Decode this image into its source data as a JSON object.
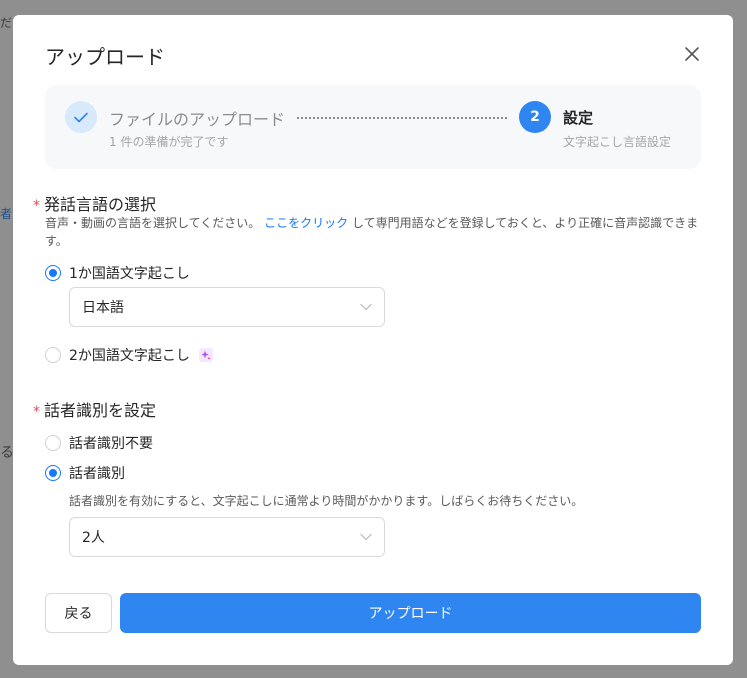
{
  "background": {
    "fragments": [
      "ださ",
      "者",
      "る"
    ]
  },
  "modal": {
    "title": "アップロード",
    "close_icon": "close-icon"
  },
  "stepper": {
    "step1": {
      "label": "ファイルのアップロード",
      "sub": "1 件の準備が完了です",
      "icon": "check-icon"
    },
    "step2": {
      "number": "2",
      "label": "設定",
      "sub": "文字起こし言語設定"
    }
  },
  "language": {
    "title": "発話言語の選択",
    "required_mark": "*",
    "desc_before": "音声・動画の言語を選択してください。",
    "desc_link": "ここをクリック",
    "desc_after": "して専門用語などを登録しておくと、より正確に音声認識できます。",
    "options": [
      {
        "label": "1か国語文字起こし",
        "checked": true
      },
      {
        "label": "2か国語文字起こし",
        "checked": false,
        "badge_icon": "sparkle-icon"
      }
    ],
    "selected_language": "日本語"
  },
  "speaker": {
    "title": "話者識別を設定",
    "required_mark": "*",
    "options": [
      {
        "label": "話者識別不要",
        "checked": false
      },
      {
        "label": "話者識別",
        "checked": true
      }
    ],
    "hint": "話者識別を有効にすると、文字起こしに通常より時間がかかります。しばらくお待ちください。",
    "selected_count": "2人"
  },
  "footer": {
    "back_label": "戻る",
    "upload_label": "アップロード"
  },
  "colors": {
    "primary": "#2f86f1",
    "link": "#1677ff",
    "required": "#e5484d",
    "overlay": "#8c8c8c"
  }
}
